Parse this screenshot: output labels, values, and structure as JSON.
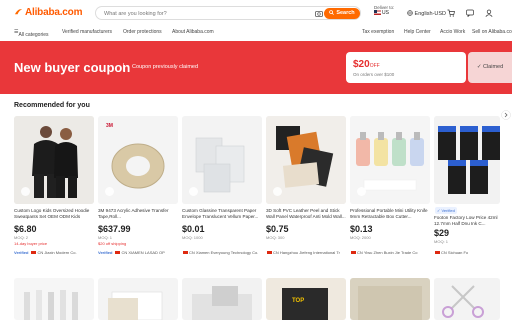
{
  "header": {
    "logo_text": "Alibaba.com",
    "search_placeholder": "What are you looking for?",
    "search_button": "Search",
    "deliver_label": "Deliver to:",
    "deliver_country": "US",
    "language_currency": "English-USD",
    "brand_color": "#ff6a00"
  },
  "subnav": {
    "all_categories": "All categories",
    "verified_manufacturers": "Verified manufacturers",
    "order_protections": "Order protections",
    "about": "About Alibaba.com",
    "tax_exemption": "Tax exemption",
    "help_center": "Help Center",
    "app": "Accio Work",
    "sell": "Sell on Alibaba.co"
  },
  "banner": {
    "title": "New buyer coupon",
    "subtitle": "Coupon previously claimed",
    "coupon_amount": "$20",
    "coupon_unit": "OFF",
    "coupon_condition": "On orders over $100",
    "claimed_label": "Claimed",
    "color": "#e9373a"
  },
  "recommended": {
    "title": "Recommended for you",
    "products": [
      {
        "title": "Custom Logo Kids Oversized Hoodie Sweatpants Set OEM ODM Kids Autumn",
        "price": "$6.80",
        "moq": "MOQ: 2",
        "extra": "14-day buyer price",
        "verified": "Verified",
        "country": "CN",
        "supplier": "Jiaxin Modern Co."
      },
      {
        "title": "3M 9473 Acrylic Adhesive Transfer Tape,Roll...",
        "price": "$637.99",
        "moq": "MOQ: 1",
        "extra": "$20 off shipping",
        "verified": "Verified",
        "country": "CN",
        "supplier": "XIAMEN LASAD OP"
      },
      {
        "title": "Custom Glassine Transparent Paper Envelope Translucent Vellum Paper...",
        "price": "$0.01",
        "moq": "MOQ: 1000",
        "extra": "",
        "verified": "",
        "country": "CN",
        "supplier": "Xiamen Everyoung Technology Co."
      },
      {
        "title": "3D Soft PVC Leather Peel and Stick Wall Panel Waterproof Anti Mold Wall...",
        "price": "$0.75",
        "moq": "MOQ: 300",
        "extra": "",
        "verified": "",
        "country": "CN",
        "supplier": "Hangzhou Jiefeng International Tr"
      },
      {
        "title": "Professional Portable Mini Utility Knife 9mm Retractable Box Cutter...",
        "price": "$0.13",
        "moq": "MOQ: 2000",
        "extra": "",
        "verified": "",
        "country": "CN",
        "supplier": "Yiwu Zhen Buxin Jie Trade Co"
      },
      {
        "title": "Footon Factory Low Price 42ml 12.7mm Half Dnu Ink C...",
        "price": "$29",
        "moq": "MOQ: 1",
        "extra": "",
        "verified": "",
        "country": "CN",
        "supplier": "Sichuan Fo",
        "badge": "Verified"
      }
    ]
  }
}
